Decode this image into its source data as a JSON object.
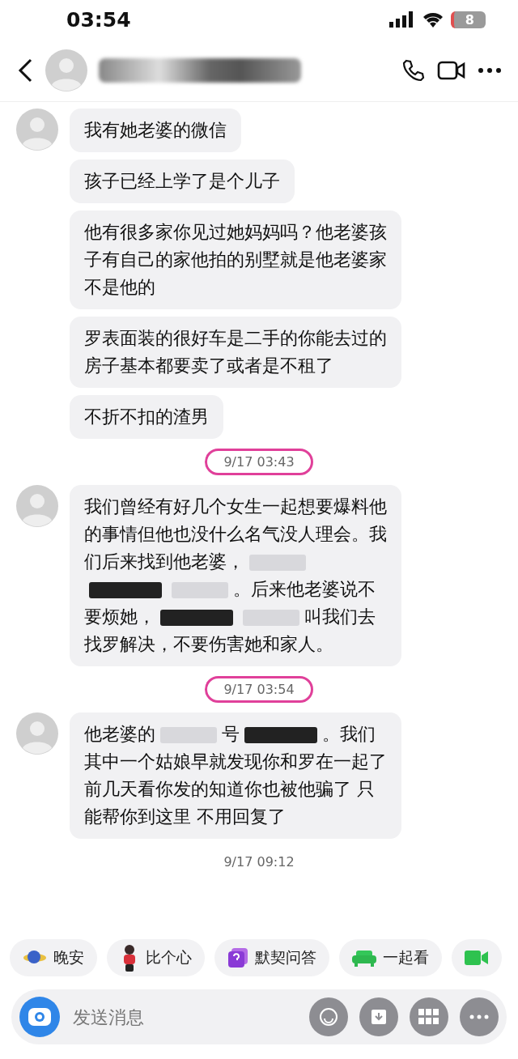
{
  "status_bar": {
    "time": "03:54",
    "battery": "8"
  },
  "messages": [
    {
      "kind": "group",
      "bubbles": [
        {
          "segments": [
            {
              "kind": "text",
              "text": "我有她老婆的微信"
            }
          ]
        },
        {
          "segments": [
            {
              "kind": "text",
              "text": "孩子已经上学了是个儿子"
            }
          ]
        },
        {
          "segments": [
            {
              "kind": "text",
              "text": "他有很多家你见过她妈妈吗？他老婆孩子有自己的家他拍的别墅就是他老婆家不是他的"
            }
          ]
        },
        {
          "segments": [
            {
              "kind": "text",
              "text": "罗表面装的很好车是二手的你能去过的房子基本都要卖了或者是不租了"
            }
          ]
        },
        {
          "segments": [
            {
              "kind": "text",
              "text": "不折不扣的渣男"
            }
          ]
        }
      ]
    },
    {
      "kind": "timestamp",
      "text": "9/17 03:43",
      "circled": true
    },
    {
      "kind": "group",
      "bubbles": [
        {
          "segments": [
            {
              "kind": "text",
              "text": "我们曾经有好几个女生一起想要爆料他的事情但他也没什么名气没人理会。我们后来找到他老婆，"
            },
            {
              "kind": "light_redaction"
            },
            {
              "kind": "dark_redaction"
            },
            {
              "kind": "light_redaction"
            },
            {
              "kind": "text",
              "text": "。后来他老婆说不要烦她，"
            },
            {
              "kind": "dark_redaction"
            },
            {
              "kind": "light_redaction"
            },
            {
              "kind": "text",
              "text": "叫我们去找罗解决，不要伤害她和家人。"
            }
          ]
        }
      ]
    },
    {
      "kind": "timestamp",
      "text": "9/17 03:54",
      "circled": true
    },
    {
      "kind": "group",
      "bubbles": [
        {
          "segments": [
            {
              "kind": "text",
              "text": "他老婆的"
            },
            {
              "kind": "light_redaction"
            },
            {
              "kind": "text",
              "text": "号"
            },
            {
              "kind": "dark_redaction"
            },
            {
              "kind": "text",
              "text": "。我们其中一个姑娘早就发现你和罗在一起了前几天看你发的知道你也被他骗了 只能帮你到这里 不用回复了"
            }
          ]
        }
      ]
    },
    {
      "kind": "timestamp",
      "text": "9/17 09:12",
      "circled": false
    }
  ],
  "quick_actions": [
    {
      "kind": "planet",
      "label": "晚安"
    },
    {
      "kind": "figure",
      "label": "比个心"
    },
    {
      "kind": "quiz",
      "label": "默契问答"
    },
    {
      "kind": "sofa",
      "label": "一起看"
    },
    {
      "kind": "video"
    }
  ],
  "composer": {
    "placeholder": "发送消息"
  }
}
